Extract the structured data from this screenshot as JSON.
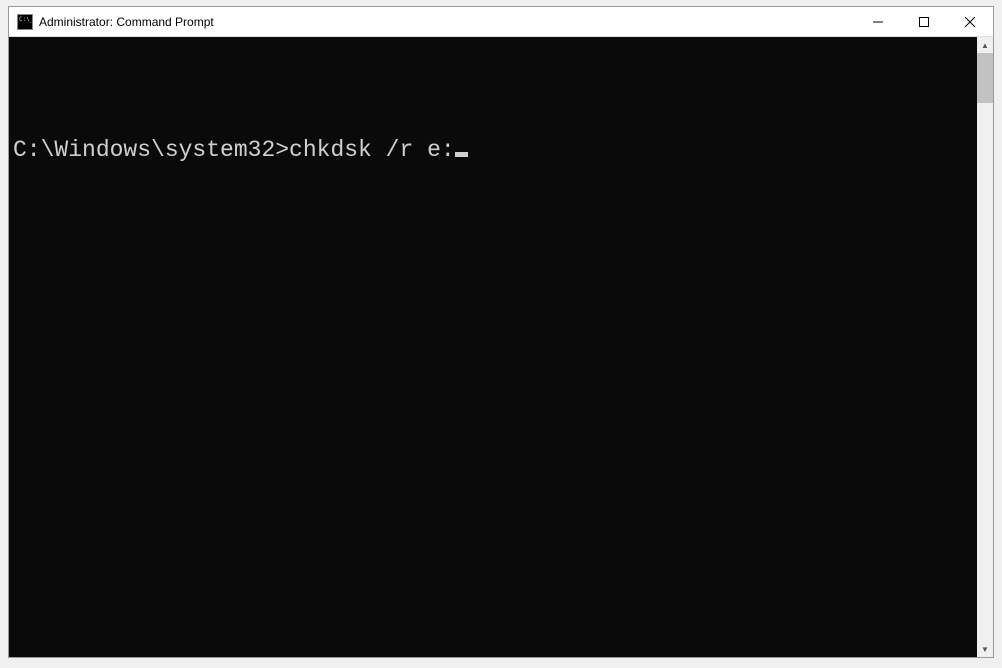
{
  "titlebar": {
    "title": "Administrator: Command Prompt"
  },
  "console": {
    "prompt": "C:\\Windows\\system32>",
    "command": "chkdsk /r e:"
  }
}
